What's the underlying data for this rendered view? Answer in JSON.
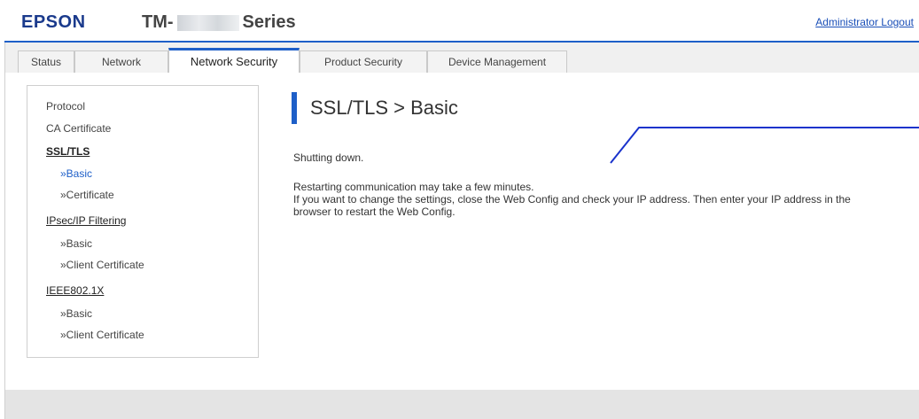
{
  "header": {
    "brand": "EPSON",
    "model_prefix": "TM-",
    "model_suffix": "Series",
    "logout_label": "Administrator Logout"
  },
  "tabs": [
    {
      "label": "Status"
    },
    {
      "label": "Network"
    },
    {
      "label": "Network Security",
      "active": true
    },
    {
      "label": "Product Security"
    },
    {
      "label": "Device Management"
    }
  ],
  "sidebar": {
    "protocol": "Protocol",
    "ca_certificate": "CA Certificate",
    "ssl_tls": "SSL/TLS",
    "ssl_basic": "»Basic",
    "ssl_certificate": "»Certificate",
    "ipsec": "IPsec/IP Filtering",
    "ipsec_basic": "»Basic",
    "ipsec_client_cert": "»Client Certificate",
    "ieee": "IEEE802.1X",
    "ieee_basic": "»Basic",
    "ieee_client_cert": "»Client Certificate"
  },
  "main": {
    "title": "SSL/TLS > Basic",
    "status": "Shutting down.",
    "line1": "Restarting communication may take a few minutes.",
    "line2": "If you want to change the settings, close the Web Config and check your IP address. Then enter your IP address in the",
    "line3": "browser to restart the Web Config."
  },
  "colors": {
    "accent": "#1e5fc8",
    "brand": "#1a3a8c",
    "callout_line": "#1a33cc"
  }
}
